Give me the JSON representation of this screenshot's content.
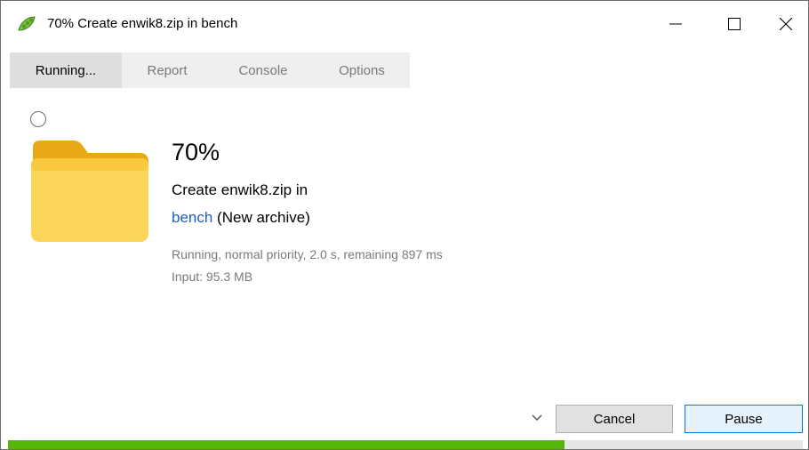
{
  "window": {
    "title": "70% Create enwik8.zip in bench",
    "app_icon": "peapod-icon",
    "controls": {
      "minimize": "minimize-icon",
      "maximize": "maximize-icon",
      "close": "close-icon"
    }
  },
  "tabs": [
    {
      "label": "Running...",
      "active": true
    },
    {
      "label": "Report",
      "active": false
    },
    {
      "label": "Console",
      "active": false
    },
    {
      "label": "Options",
      "active": false
    }
  ],
  "task": {
    "percent_text": "70%",
    "action": "Create enwik8.zip in",
    "destination_link": "bench",
    "destination_suffix": " (New archive)",
    "status": "Running, normal priority, 2.0 s, remaining 897 ms",
    "input": "Input: 95.3 MB",
    "folder_icon": "folder-icon"
  },
  "buttons": {
    "cancel": "Cancel",
    "pause": "Pause",
    "expand_icon": "chevron-down-icon"
  },
  "progress": {
    "fraction": 0.7,
    "color": "#56b50a"
  },
  "colors": {
    "accent": "#0078d7",
    "link": "#1f5fbf",
    "folder": "#f5c542"
  }
}
